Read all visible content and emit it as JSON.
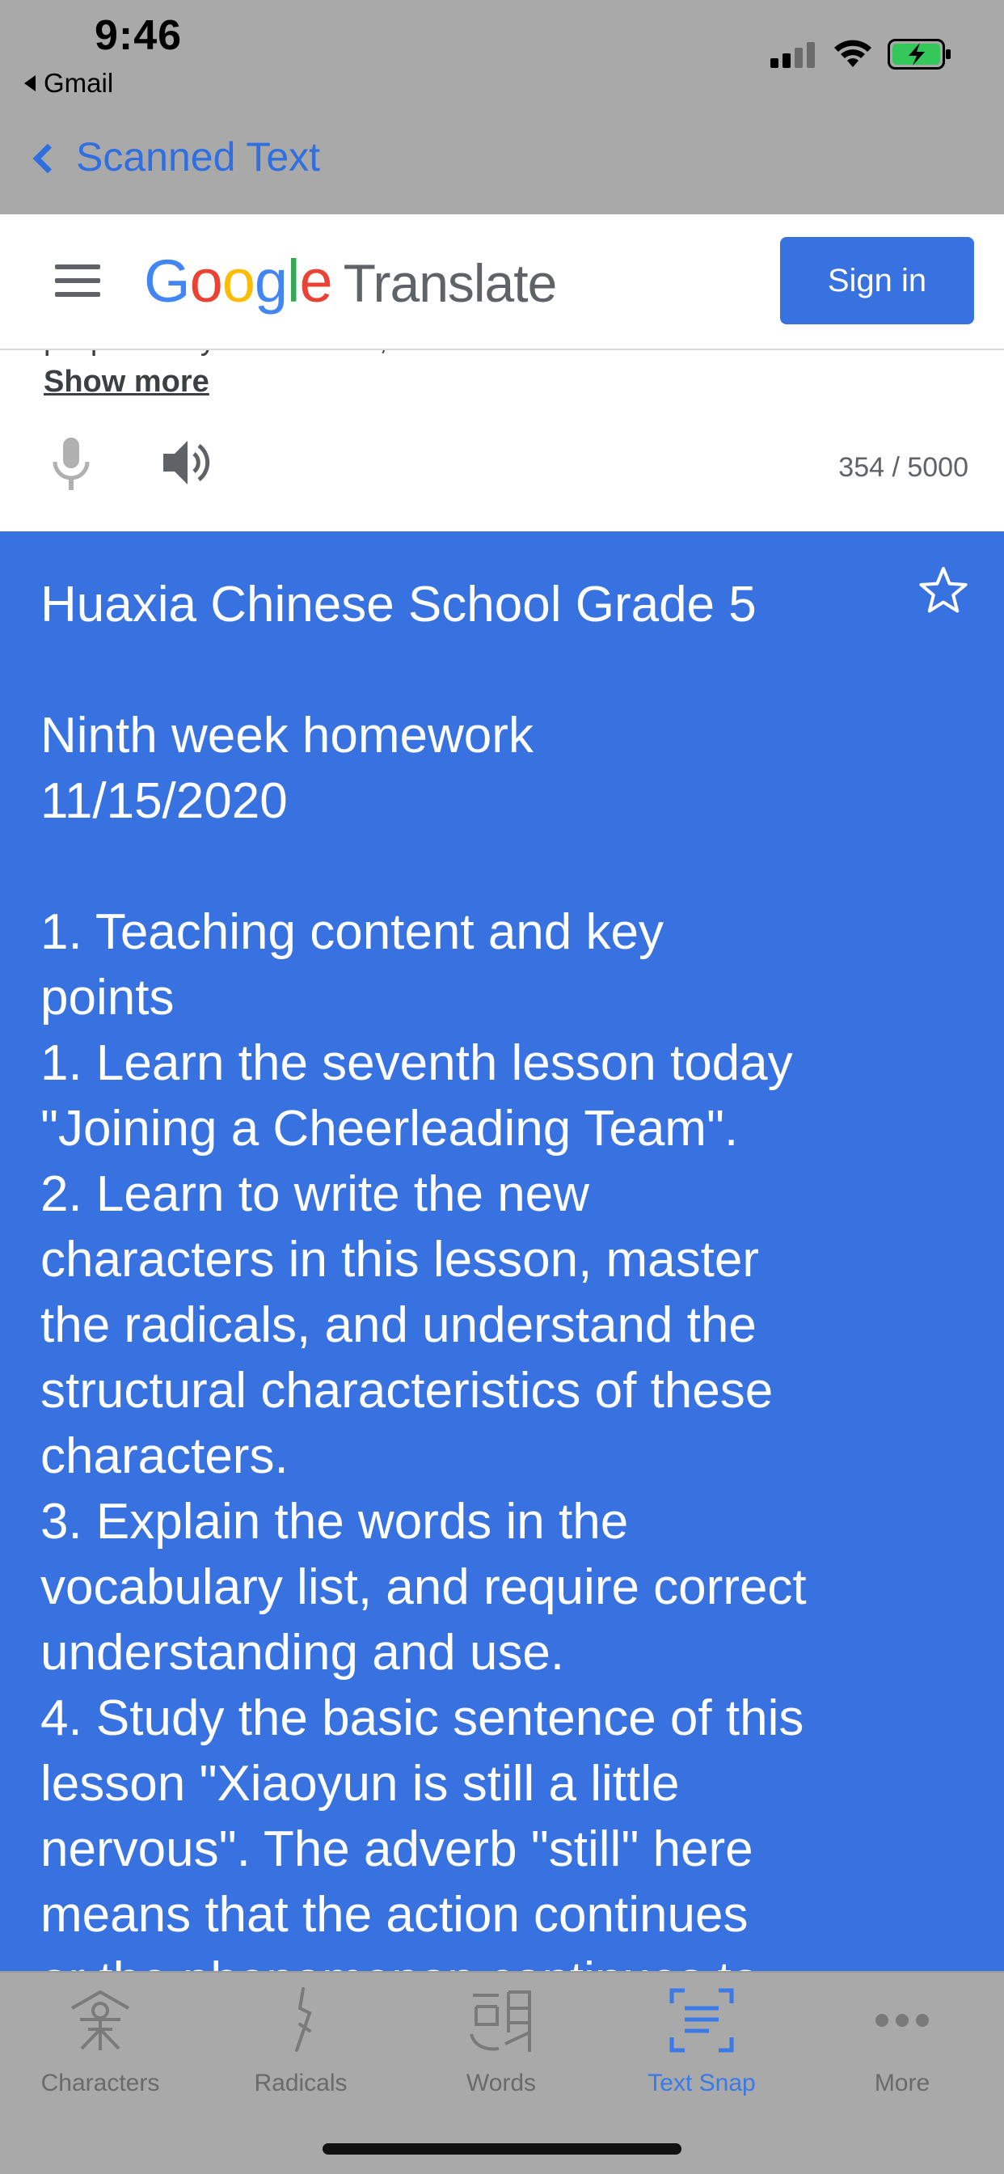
{
  "status": {
    "time": "9:46",
    "back_app": "Gmail"
  },
  "nav": {
    "back_label": "Scanned Text"
  },
  "header": {
    "logo_word": "Google",
    "logo_product": "Translate",
    "sign_in_label": "Sign in"
  },
  "input": {
    "partial_line": "prepared by                    in Chinese,",
    "show_more": "Show more",
    "char_count": "354 / 5000"
  },
  "result": {
    "text": "Huaxia Chinese School Grade 5\n\nNinth week homework\n11/15/2020\n\n1. Teaching content and key\npoints\n1. Learn the seventh lesson today\n\"Joining a Cheerleading Team\".\n2. Learn to write the new\ncharacters in this lesson, master\nthe radicals, and understand the\nstructural characteristics of these\ncharacters.\n3. Explain the words in the\nvocabulary list, and require correct\nunderstanding and use.\n4. Study the basic sentence of this\nlesson \"Xiaoyun is still a little\nnervous\". The adverb \"still\" here\nmeans that the action continues\nor the phenomenon continues to"
  },
  "tabs": [
    {
      "label": "Characters",
      "icon": "characters-icon",
      "active": false
    },
    {
      "label": "Radicals",
      "icon": "radicals-icon",
      "active": false
    },
    {
      "label": "Words",
      "icon": "words-icon",
      "active": false
    },
    {
      "label": "Text Snap",
      "icon": "text-snap-icon",
      "active": true
    },
    {
      "label": "More",
      "icon": "more-icon",
      "active": false
    }
  ],
  "colors": {
    "accent": "#3872e0",
    "tab_active": "#3a79e8",
    "chrome_gray": "#a9a9a9"
  }
}
